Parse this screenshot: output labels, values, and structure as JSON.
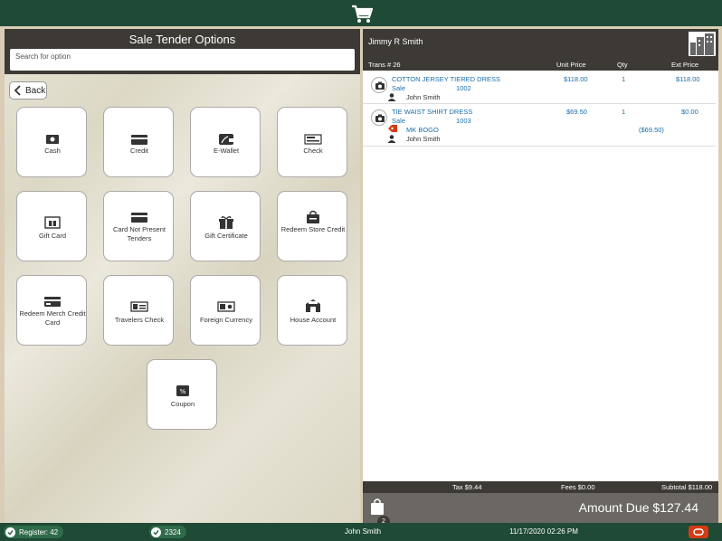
{
  "left_panel": {
    "title": "Sale Tender Options",
    "search_placeholder": "Search for option",
    "back_label": "Back",
    "tiles": [
      {
        "label": "Cash",
        "icon": "cash-icon"
      },
      {
        "label": "Credit",
        "icon": "credit-card-icon"
      },
      {
        "label": "E-Wallet",
        "icon": "wallet-icon"
      },
      {
        "label": "Check",
        "icon": "check-icon"
      },
      {
        "label": "Gift Card",
        "icon": "gift-card-icon"
      },
      {
        "label": "Card Not Present Tenders",
        "icon": "card-not-present-icon"
      },
      {
        "label": "Gift Certificate",
        "icon": "gift-certificate-icon"
      },
      {
        "label": "Redeem Store Credit",
        "icon": "store-credit-icon"
      },
      {
        "label": "Redeem Merch Credit Card",
        "icon": "merch-credit-card-icon"
      },
      {
        "label": "Travelers Check",
        "icon": "travelers-check-icon"
      },
      {
        "label": "Foreign Currency",
        "icon": "foreign-currency-icon"
      },
      {
        "label": "House Account",
        "icon": "house-account-icon"
      },
      {
        "label": "Coupon",
        "icon": "coupon-icon"
      }
    ]
  },
  "right_panel": {
    "customer_name": "Jimmy R Smith",
    "columns": {
      "trans": "Trans # 26",
      "unit_price": "Unit Price",
      "qty": "Qty",
      "ext_price": "Ext Price"
    },
    "items": [
      {
        "name": "COTTON JERSEY TIERED DRESS",
        "type": "Sale",
        "sku": "1002",
        "unit_price": "$118.00",
        "qty": "1",
        "ext_price": "$118.00",
        "salesperson": "John Smith"
      },
      {
        "name": "TIE WAIST SHIRT DRESS",
        "type": "Sale",
        "sku": "1003",
        "unit_price": "$69.50",
        "qty": "1",
        "ext_price": "$0.00",
        "discount_name": "MK BOGO",
        "discount_amount": "($69.50)",
        "salesperson": "John Smith"
      }
    ],
    "totals": {
      "tax": "Tax $9.44",
      "fees": "Fees $0.00",
      "subtotal": "Subtotal $118.00"
    },
    "bag_count": "2",
    "amount_due": "Amount Due $127.44"
  },
  "status_bar": {
    "register": "Register: 42",
    "code": "2324",
    "user": "John Smith",
    "datetime": "11/17/2020 02:26 PM"
  },
  "colors": {
    "brand_green": "#1f4a35",
    "header_dark": "#3d3a36",
    "link_blue": "#1a6ea8",
    "oracle_red": "#d33b12"
  }
}
